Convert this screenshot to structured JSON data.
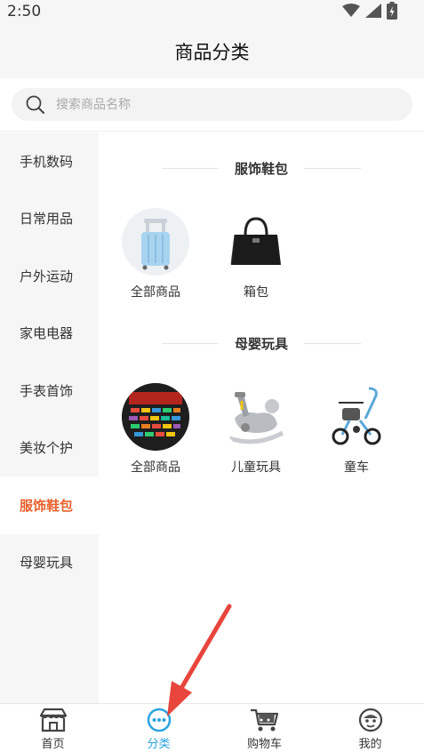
{
  "status_bar": {
    "time": "2:50"
  },
  "header": {
    "title": "商品分类"
  },
  "search": {
    "placeholder": "搜索商品名称",
    "value": ""
  },
  "sidebar": {
    "items": [
      {
        "label": "手机数码",
        "active": false
      },
      {
        "label": "日常用品",
        "active": false
      },
      {
        "label": "户外运动",
        "active": false
      },
      {
        "label": "家电电器",
        "active": false
      },
      {
        "label": "手表首饰",
        "active": false
      },
      {
        "label": "美妆个护",
        "active": false
      },
      {
        "label": "服饰鞋包",
        "active": true
      },
      {
        "label": "母婴玩具",
        "active": false
      }
    ]
  },
  "sections": [
    {
      "title": "服饰鞋包",
      "items": [
        {
          "label": "全部商品"
        },
        {
          "label": "箱包"
        }
      ]
    },
    {
      "title": "母婴玩具",
      "items": [
        {
          "label": "全部商品"
        },
        {
          "label": "儿童玩具"
        },
        {
          "label": "童车"
        }
      ]
    }
  ],
  "tabbar": {
    "tabs": [
      {
        "label": "首页",
        "icon": "store-icon"
      },
      {
        "label": "分类",
        "icon": "category-dots-icon",
        "active": true
      },
      {
        "label": "购物车",
        "icon": "cart-icon"
      },
      {
        "label": "我的",
        "icon": "profile-face-icon"
      }
    ]
  },
  "colors": {
    "accent": "#e8612c",
    "tab_active": "#29a3e0",
    "annotation_arrow": "#e8453c"
  }
}
